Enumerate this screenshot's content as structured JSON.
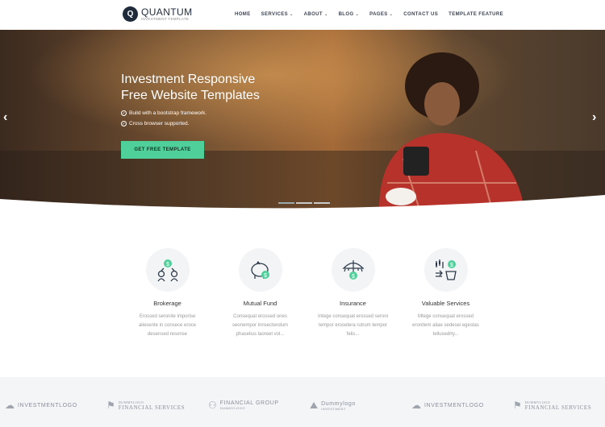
{
  "brand": {
    "name": "QUANTUM",
    "tagline": "INVESTMENT TEMPLATE",
    "mark": "Q"
  },
  "nav": [
    {
      "label": "HOME",
      "dropdown": false
    },
    {
      "label": "SERVICES",
      "dropdown": true
    },
    {
      "label": "ABOUT",
      "dropdown": true
    },
    {
      "label": "BLOG",
      "dropdown": true
    },
    {
      "label": "PAGES",
      "dropdown": true
    },
    {
      "label": "CONTACT US",
      "dropdown": false
    },
    {
      "label": "TEMPLATE FEATURE",
      "dropdown": false
    }
  ],
  "hero": {
    "title_line1": "Investment Responsive",
    "title_line2": "Free Website Templates",
    "bullets": [
      "Build with a bootstrap framework.",
      "Cross browser supported."
    ],
    "cta": "GET FREE TEMPLATE",
    "prev_glyph": "‹",
    "next_glyph": "›",
    "slide_count": 3,
    "active_slide": 1
  },
  "services": [
    {
      "title": "Brokerage",
      "desc": "Erossed seronite imporise aliesente in consece eroce desensed resonse",
      "icon": "brokerage-icon"
    },
    {
      "title": "Mutual Fund",
      "desc": "Consequat erossed ones seonempor innsectendum phaselius laoreet vol...",
      "icon": "piggy-bank-icon"
    },
    {
      "title": "Insurance",
      "desc": "Intege consequat erossed seroni tempor erosetera rutrum tempor felis...",
      "icon": "umbrella-icon"
    },
    {
      "title": "Valuable Services",
      "desc": "Mtege consequat erossed eronitem aliae sedesei egestas tellusedrty...",
      "icon": "money-bag-icon"
    }
  ],
  "partners": [
    {
      "text": "INVESTMENTLOGO",
      "sub": ""
    },
    {
      "text": "FINANCIAL SERVICES",
      "sub": "DUMMYLOGO"
    },
    {
      "text": "FINANCIAL GROUP",
      "sub": "DUMMYLOGO"
    },
    {
      "text": "Dummylogo",
      "sub": "INVESTMENT"
    },
    {
      "text": "INVESTMENTLOGO",
      "sub": ""
    },
    {
      "text": "FINANCIAL SERVICES",
      "sub": "DUMMYLOGO"
    }
  ],
  "colors": {
    "accent": "#4fd09b",
    "navy": "#1f2a3a",
    "hero_warm": "#6b4a2a"
  }
}
